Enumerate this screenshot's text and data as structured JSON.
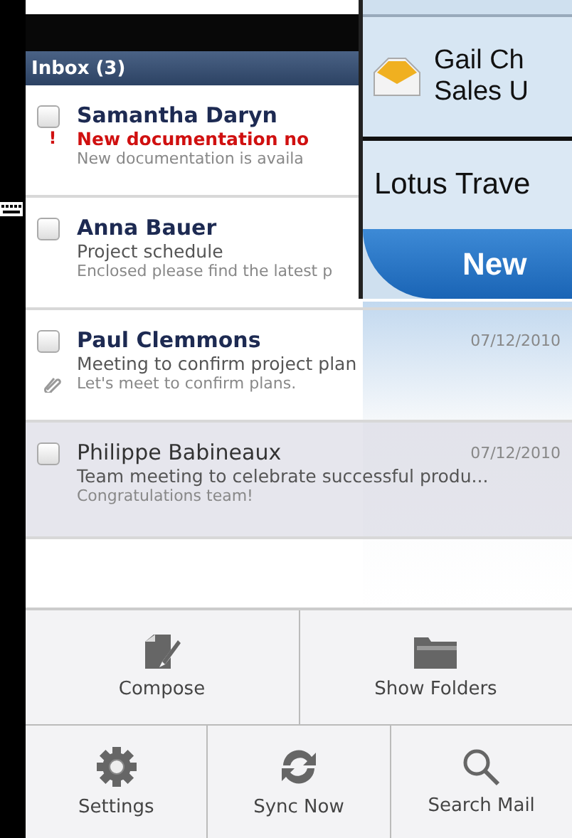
{
  "inbox": {
    "title": "Inbox (3)"
  },
  "messages": [
    {
      "sender": "Samantha Daryn",
      "unread": true,
      "priority": "!",
      "subject": "New documentation no",
      "preview": "New documentation is availa",
      "attachment": false,
      "selected": false
    },
    {
      "sender": "Anna Bauer",
      "unread": true,
      "subject": "Project schedule",
      "preview": "Enclosed please find the latest p",
      "attachment": false,
      "selected": false
    },
    {
      "sender": "Paul Clemmons",
      "unread": true,
      "subject": "Meeting to confirm project plan",
      "preview": "Let's meet to confirm plans.",
      "date": "07/12/2010",
      "attachment": true,
      "selected": false
    },
    {
      "sender": "Philippe Babineaux",
      "unread": false,
      "subject": "Team meeting to celebrate successful produ...",
      "preview": "Congratulations team!",
      "date": "07/12/2010",
      "attachment": false,
      "selected": true
    }
  ],
  "menu": [
    [
      {
        "label": "Compose",
        "kind": "compose"
      },
      {
        "label": "Show Folders",
        "kind": "folder"
      }
    ],
    [
      {
        "label": "Settings",
        "kind": "gear"
      },
      {
        "label": "Sync Now",
        "kind": "sync"
      },
      {
        "label": "Search Mail",
        "kind": "search"
      }
    ]
  ],
  "overlay": {
    "contact_name": "Gail Ch",
    "contact_detail": "Sales U",
    "item": "Lotus Trave",
    "button": "New"
  }
}
